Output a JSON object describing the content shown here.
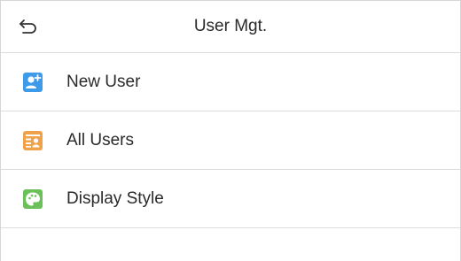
{
  "header": {
    "title": "User Mgt.",
    "back_icon": "return-arrow-icon"
  },
  "menu": {
    "items": [
      {
        "label": "New User",
        "icon": "add-user-icon",
        "icon_color": "#3d9be9"
      },
      {
        "label": "All Users",
        "icon": "user-list-icon",
        "icon_color": "#f0a24a"
      },
      {
        "label": "Display Style",
        "icon": "palette-icon",
        "icon_color": "#6cc05a"
      }
    ]
  }
}
